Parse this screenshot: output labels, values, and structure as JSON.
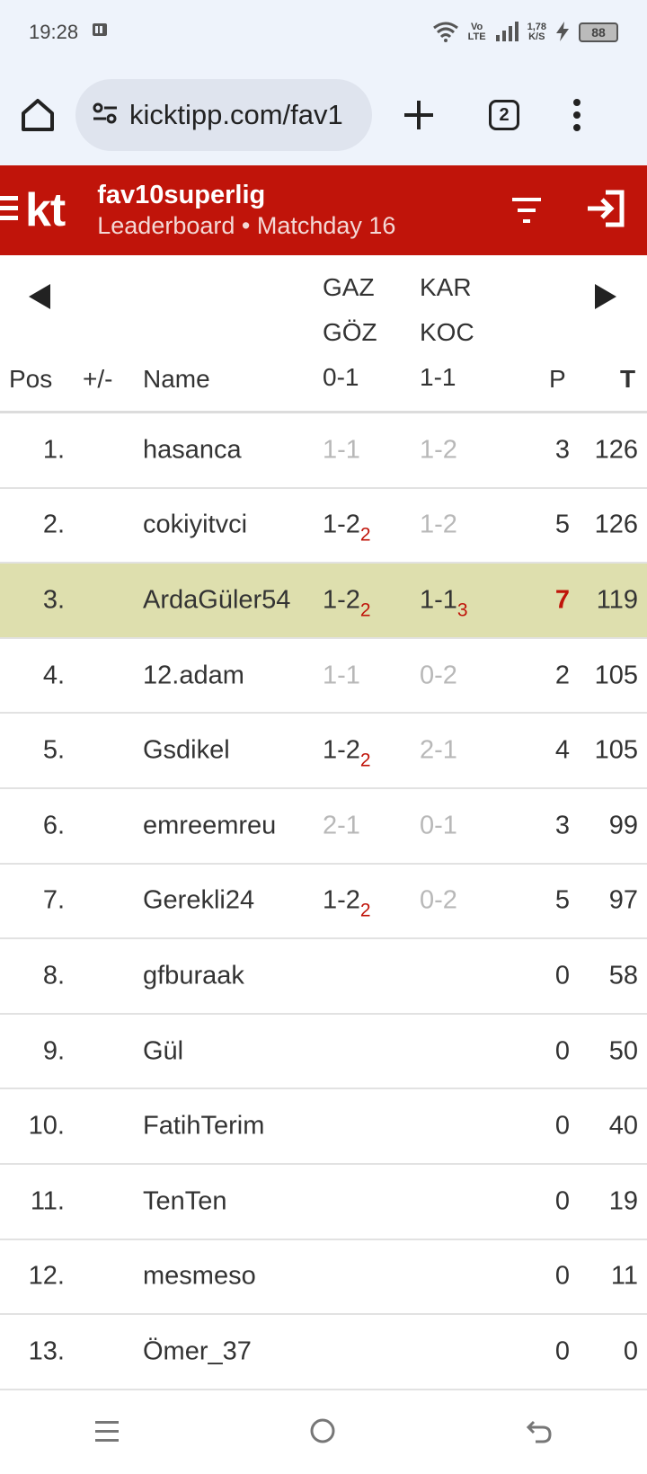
{
  "status": {
    "time": "19:28",
    "net_top": "Vo",
    "net_bottom": "LTE",
    "speed_top": "1,78",
    "speed_bottom": "K/S",
    "battery": "88"
  },
  "browser": {
    "url": "kicktipp.com/fav1",
    "tab_count": "2"
  },
  "header": {
    "logo": "kt",
    "title": "fav10superlig",
    "subtitle": "Leaderboard • Matchday 16"
  },
  "table": {
    "col_pos": "Pos",
    "col_diff": "+/-",
    "col_name": "Name",
    "col_p": "P",
    "col_t": "T",
    "game1": {
      "home": "GAZ",
      "away": "GÖZ",
      "score": "0-1"
    },
    "game2": {
      "home": "KAR",
      "away": "KOC",
      "score": "1-1"
    },
    "rows": [
      {
        "pos": "1.",
        "name": "hasanca",
        "g1": "1-1",
        "g1_bonus": "",
        "g2": "1-2",
        "g2_bonus": "",
        "p": "3",
        "t": "126"
      },
      {
        "pos": "2.",
        "name": "cokiyitvci",
        "g1": "1-2",
        "g1_bonus": "2",
        "g2": "1-2",
        "g2_bonus": "",
        "p": "5",
        "t": "126"
      },
      {
        "pos": "3.",
        "name": "ArdaGüler54",
        "g1": "1-2",
        "g1_bonus": "2",
        "g2": "1-1",
        "g2_bonus": "3",
        "p": "7",
        "t": "119"
      },
      {
        "pos": "4.",
        "name": "12.adam",
        "g1": "1-1",
        "g1_bonus": "",
        "g2": "0-2",
        "g2_bonus": "",
        "p": "2",
        "t": "105"
      },
      {
        "pos": "5.",
        "name": "Gsdikel",
        "g1": "1-2",
        "g1_bonus": "2",
        "g2": "2-1",
        "g2_bonus": "",
        "p": "4",
        "t": "105"
      },
      {
        "pos": "6.",
        "name": "emreemreu",
        "g1": "2-1",
        "g1_bonus": "",
        "g2": "0-1",
        "g2_bonus": "",
        "p": "3",
        "t": "99"
      },
      {
        "pos": "7.",
        "name": "Gerekli24",
        "g1": "1-2",
        "g1_bonus": "2",
        "g2": "0-2",
        "g2_bonus": "",
        "p": "5",
        "t": "97"
      },
      {
        "pos": "8.",
        "name": "gfburaak",
        "g1": "",
        "g1_bonus": "",
        "g2": "",
        "g2_bonus": "",
        "p": "0",
        "t": "58"
      },
      {
        "pos": "9.",
        "name": "Gül",
        "g1": "",
        "g1_bonus": "",
        "g2": "",
        "g2_bonus": "",
        "p": "0",
        "t": "50"
      },
      {
        "pos": "10.",
        "name": "FatihTerim",
        "g1": "",
        "g1_bonus": "",
        "g2": "",
        "g2_bonus": "",
        "p": "0",
        "t": "40"
      },
      {
        "pos": "11.",
        "name": "TenTen",
        "g1": "",
        "g1_bonus": "",
        "g2": "",
        "g2_bonus": "",
        "p": "0",
        "t": "19"
      },
      {
        "pos": "12.",
        "name": "mesmeso",
        "g1": "",
        "g1_bonus": "",
        "g2": "",
        "g2_bonus": "",
        "p": "0",
        "t": "11"
      },
      {
        "pos": "13.",
        "name": "Ömer_37",
        "g1": "",
        "g1_bonus": "",
        "g2": "",
        "g2_bonus": "",
        "p": "0",
        "t": "0"
      }
    ]
  },
  "theme": {
    "brand": "#c0140a",
    "highlight": "#dedfae"
  }
}
